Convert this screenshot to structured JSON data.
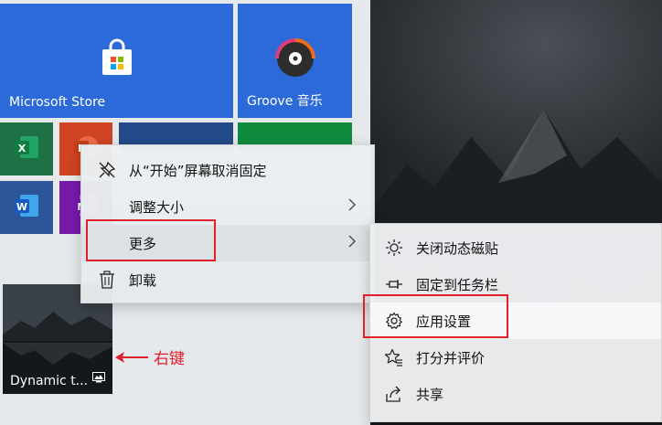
{
  "tiles": {
    "store_label": "Microsoft Store",
    "groove_label": "Groove 音乐",
    "dynamic_label": "Dynamic t..."
  },
  "context_menu": {
    "items": [
      {
        "label": "从“开始”屏幕取消固定",
        "icon": "unpin-icon"
      },
      {
        "label": "调整大小",
        "icon": "none",
        "has_submenu": true
      },
      {
        "label": "更多",
        "icon": "none",
        "has_submenu": true,
        "highlighted": true
      },
      {
        "label": "卸载",
        "icon": "trash-icon"
      }
    ]
  },
  "submenu": {
    "items": [
      {
        "label": "关闭动态磁贴",
        "icon": "live-tile-icon"
      },
      {
        "label": "固定到任务栏",
        "icon": "pin-icon"
      },
      {
        "label": "应用设置",
        "icon": "gear-icon",
        "highlighted": true
      },
      {
        "label": "打分并评价",
        "icon": "star-rate-icon"
      },
      {
        "label": "共享",
        "icon": "share-icon"
      }
    ]
  },
  "annotation": {
    "label": "右键",
    "color": "#e0202a"
  },
  "colors": {
    "store_tile": "#2b6ad8",
    "groove_tile": "#2b6ad8",
    "green_tile": "#108b3e",
    "excel": "#1e7145",
    "powerpoint": "#d04423",
    "word": "#2b579a",
    "onenote": "#7719aa",
    "highlight": "#e0202a"
  }
}
